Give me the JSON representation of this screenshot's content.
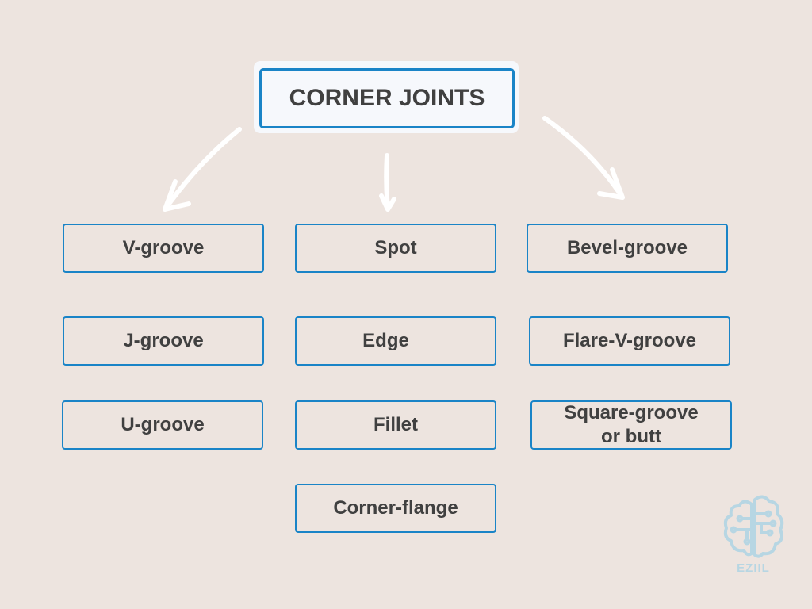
{
  "title": "CORNER JOINTS",
  "columns": [
    {
      "items": [
        "V-groove",
        "J-groove",
        "U-groove"
      ]
    },
    {
      "items": [
        "Spot",
        "Edge",
        "Fillet",
        "Corner-flange"
      ]
    },
    {
      "items": [
        "Bevel-groove",
        "Flare-V-groove",
        "Square-groove or butt"
      ]
    }
  ],
  "nodes": {
    "v_groove": "V-groove",
    "j_groove": "J-groove",
    "u_groove": "U-groove",
    "spot": "Spot",
    "edge": "Edge",
    "fillet": "Fillet",
    "corner_flange": "Corner-flange",
    "bevel_groove": "Bevel-groove",
    "flare_v_groove": "Flare-V-groove",
    "square_groove_line1": "Square-groove",
    "square_groove_line2": "or butt"
  },
  "logo": {
    "icon": "brain-circuit-icon",
    "text": "EZIIL"
  },
  "colors": {
    "background": "#ede4df",
    "border": "#1a84c7",
    "text": "#404040",
    "logo": "#b7d6e3"
  }
}
